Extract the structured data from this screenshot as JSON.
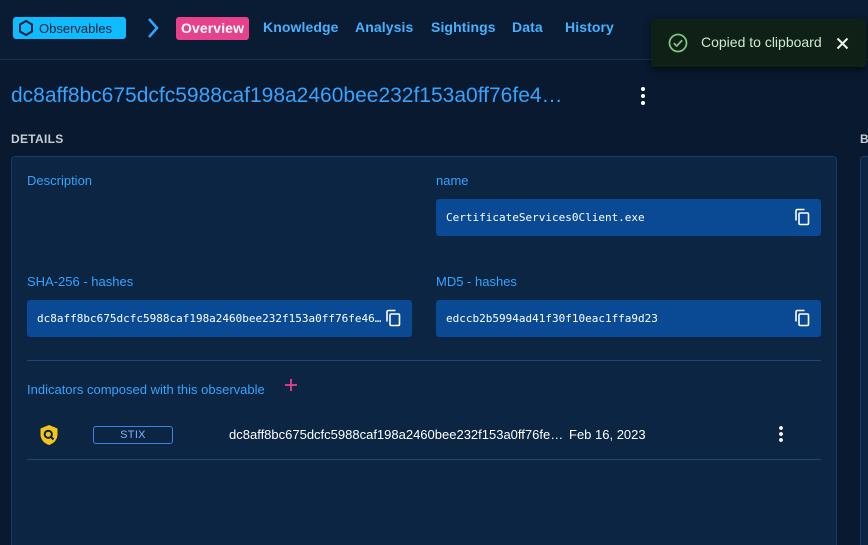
{
  "breadcrumb": {
    "entity_type": "Observables"
  },
  "tabs": [
    {
      "label": "Overview",
      "active": true
    },
    {
      "label": "Knowledge"
    },
    {
      "label": "Analysis"
    },
    {
      "label": "Sightings"
    },
    {
      "label": "Data"
    },
    {
      "label": "History"
    }
  ],
  "toast": {
    "message": "Copied to clipboard",
    "icon": "check-circle-icon"
  },
  "page_title": "dc8aff8bc675dcfc5988caf198a2460bee232f153a0ff76fe4…",
  "details": {
    "section_label": "DETAILS",
    "description_label": "Description",
    "name_label": "name",
    "name_value": "CertificateServices0Client.exe",
    "sha256_label": "SHA-256 - hashes",
    "sha256_value": "dc8aff8bc675dcfc5988caf198a2460bee232f153a0ff76fe46…",
    "md5_label": "MD5 - hashes",
    "md5_value": "edccb2b5994ad41f30f10eac1ffa9d23"
  },
  "right_section_label": "B",
  "indicators": {
    "label": "Indicators composed with this observable",
    "items": [
      {
        "type_badge": "STIX",
        "name": "dc8aff8bc675dcfc5988caf198a2460bee232f153a0ff76fe46…",
        "date": "Feb 16, 2023"
      }
    ]
  },
  "colors": {
    "background": "#091a30",
    "accent": "#36a3ff",
    "active_tab": "#e8418b",
    "value_box": "#0a4a94",
    "indicator_icon": "#f5c518"
  }
}
